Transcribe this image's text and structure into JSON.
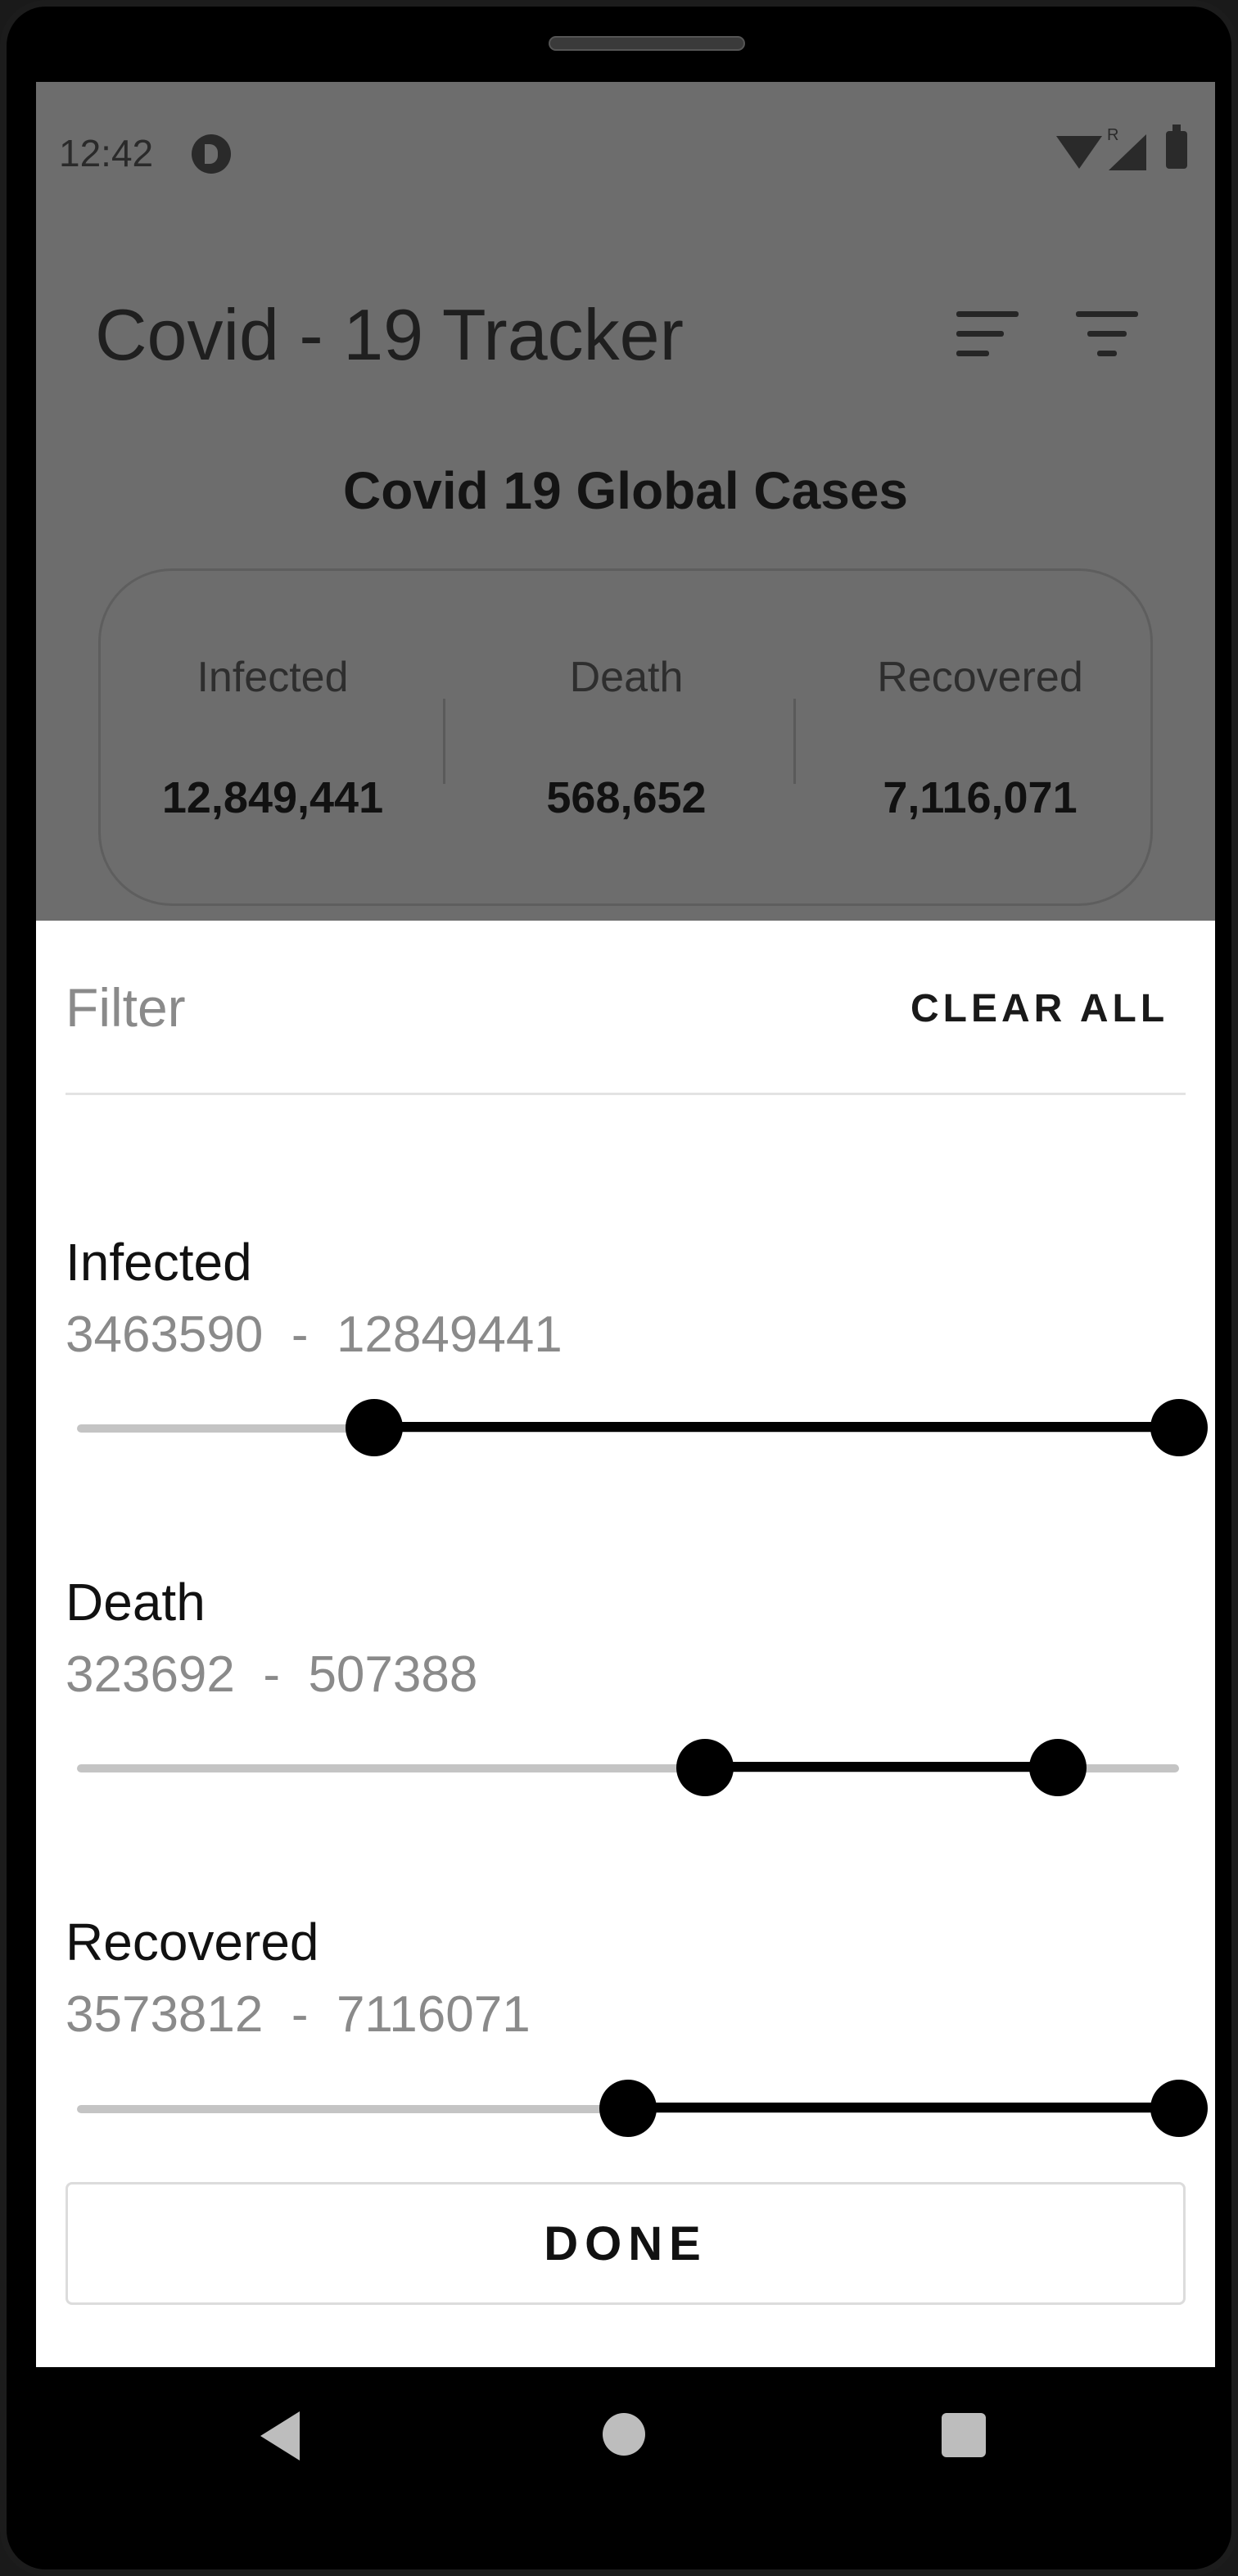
{
  "status_bar": {
    "time": "12:42",
    "signal_flag": "R"
  },
  "app_bar": {
    "title": "Covid - 19 Tracker",
    "icons": [
      "sort-icon",
      "filter-icon"
    ]
  },
  "global": {
    "title": "Covid 19 Global Cases",
    "stats": [
      {
        "label": "Infected",
        "value": "12,849,441"
      },
      {
        "label": "Death",
        "value": "568,652"
      },
      {
        "label": "Recovered",
        "value": "7,116,071"
      }
    ]
  },
  "filter_sheet": {
    "title": "Filter",
    "clear_all_label": "CLEAR ALL",
    "filters": [
      {
        "label": "Infected",
        "range_min": "3463590",
        "range_sep": "  -  ",
        "range_max": "12849441",
        "low_fraction": 0.27,
        "high_fraction": 1.0
      },
      {
        "label": "Death",
        "range_min": "323692",
        "range_sep": "  -  ",
        "range_max": "507388",
        "low_fraction": 0.57,
        "high_fraction": 0.89
      },
      {
        "label": "Recovered",
        "range_min": "3573812",
        "range_sep": "  -  ",
        "range_max": "7116071",
        "low_fraction": 0.5,
        "high_fraction": 1.0
      }
    ],
    "done_label": "DONE"
  },
  "colors": {
    "scrim": "#6d6d6d",
    "slider_active": "#000000",
    "slider_track": "#c4c4c4"
  }
}
